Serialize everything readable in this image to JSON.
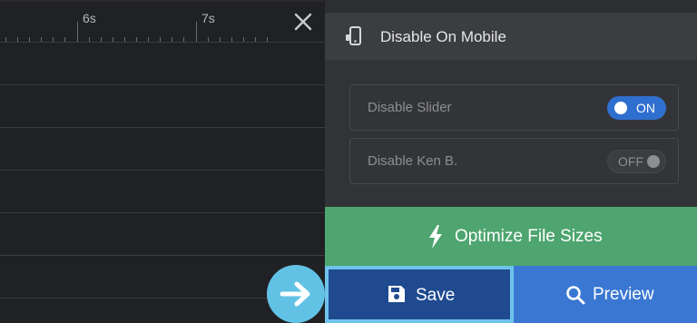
{
  "timeline": {
    "tick_labels": [
      "6s",
      "7s"
    ]
  },
  "panel": {
    "header_title": "Disable On Mobile",
    "options": [
      {
        "label": "Disable Slider",
        "toggle": "ON",
        "enabled": true
      },
      {
        "label": "Disable Ken B.",
        "toggle": "OFF",
        "enabled": false
      }
    ]
  },
  "actions": {
    "optimize_label": "Optimize File Sizes",
    "save_label": "Save",
    "preview_label": "Preview"
  },
  "colors": {
    "optimize": "#4ea56f",
    "save": "#1f4a8f",
    "preview": "#3a77d3",
    "toggle_on": "#2f6fcf",
    "arrow_bubble": "#62c2e6"
  },
  "icons": {
    "header": "mobile-disable-icon",
    "close": "close-icon",
    "optimize": "lightning-icon",
    "save": "floppy-disk-icon",
    "preview": "search-icon",
    "pointer": "arrow-right-icon"
  }
}
